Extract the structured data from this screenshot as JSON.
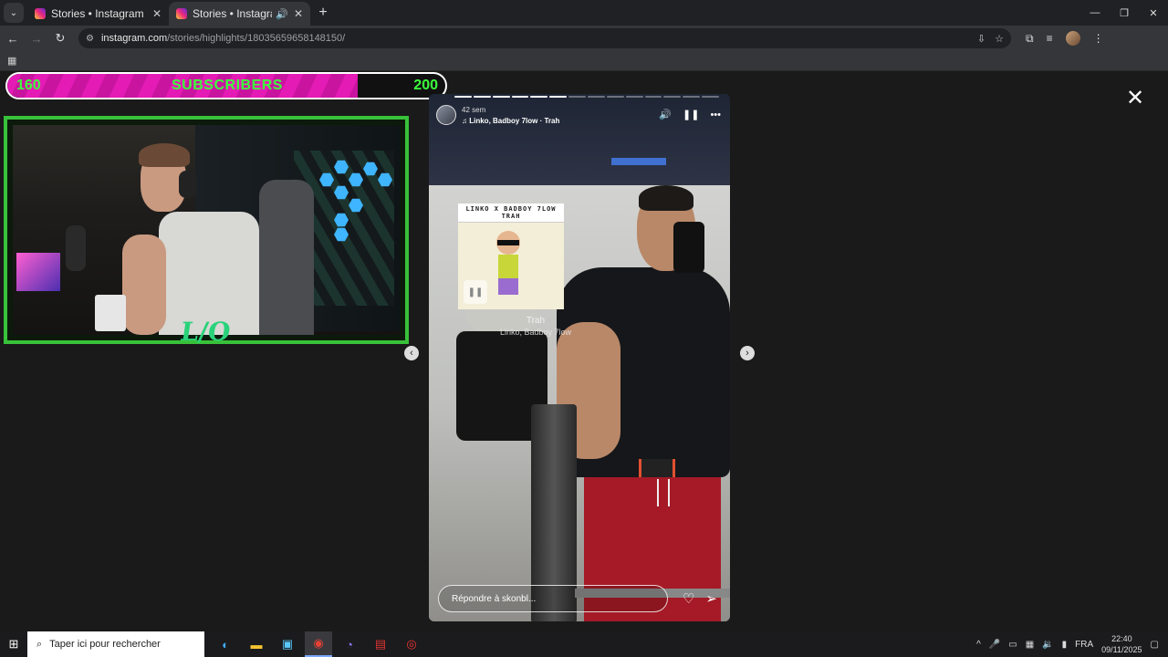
{
  "browser": {
    "tabs": [
      {
        "title": "Stories • Instagram",
        "active": false
      },
      {
        "title": "Stories • Instagram",
        "active": true
      }
    ],
    "url_host": "instagram.com",
    "url_path": "/stories/highlights/18035659658148150/"
  },
  "overlay": {
    "sub_current": "160",
    "sub_label": "SUBSCRIBERS",
    "sub_goal": "200",
    "sub_progress": 0.8,
    "cam_logo": "L/O"
  },
  "story": {
    "time": "42 sem",
    "music": "Linko, Badboy 7low · Trah",
    "sticker_title": "LINKO X BADBOY 7LOW TRAH",
    "sticker_song": "Trah",
    "sticker_artist": "Linko, Badboy 7low",
    "reply_placeholder": "Répondre à skonbl...",
    "segments_total": 14,
    "segments_done": 6
  },
  "taskbar": {
    "search_placeholder": "Taper ici pour rechercher",
    "lang": "FRA",
    "time": "22:40",
    "date": "09/11/2025"
  },
  "colors": {
    "sub_fill": "#e41bb5",
    "sub_text": "#3cff3c",
    "cam_border": "#38c23a"
  }
}
